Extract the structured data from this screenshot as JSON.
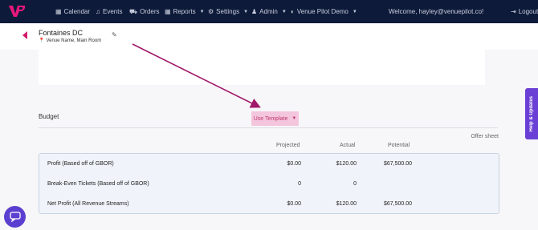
{
  "nav": {
    "items": [
      {
        "label": "Calendar",
        "icon": "calendar-icon"
      },
      {
        "label": "Events",
        "icon": "music-icon"
      },
      {
        "label": "Orders",
        "icon": "cart-icon"
      },
      {
        "label": "Reports",
        "icon": "grid-icon"
      },
      {
        "label": "Settings",
        "icon": "gear-icon"
      },
      {
        "label": "Admin",
        "icon": "user-icon"
      },
      {
        "label": "Venue Pilot Demo",
        "icon": "globe-icon"
      }
    ],
    "welcome": "Welcome, hayley@venuepilot.co!",
    "logout": "Logout"
  },
  "venue": {
    "title": "Fontaines DC",
    "subtitle": "Venue Name, Main Room"
  },
  "budget": {
    "label": "Budget",
    "template_button": "Use Template",
    "offer_sheet": "Offer sheet",
    "columns": [
      "Projected",
      "Actual",
      "Potential"
    ],
    "rows": [
      {
        "label": "Profit (Based off of GBOR)",
        "projected": "$0.00",
        "actual": "$120.00",
        "potential": "$67,500.00"
      },
      {
        "label": "Break-Even Tickets (Based off of GBOR)",
        "projected": "0",
        "actual": "0",
        "potential": ""
      },
      {
        "label": "Net Profit (All Revenue Streams)",
        "projected": "$0.00",
        "actual": "$120.00",
        "potential": "$67,500.00"
      }
    ]
  },
  "help_tab": "Help & Updates",
  "colors": {
    "nav_bg": "#0e1a3a",
    "accent": "#d6196b",
    "annotation_arrow": "#a0186a",
    "help_tab": "#6a3fd6"
  }
}
